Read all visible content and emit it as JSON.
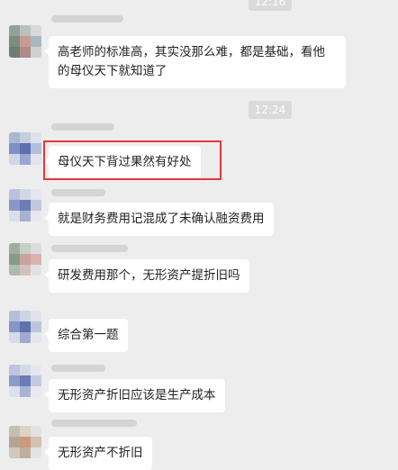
{
  "timestamps": [
    "12:16",
    "12:24"
  ],
  "messages": [
    {
      "text": "高老师的标准高，其实没那么难，都是基础，看他的母仪天下就知道了"
    },
    {
      "text": "母仪天下背过果然有好处"
    },
    {
      "text": "就是财务费用记混成了未确认融资费用"
    },
    {
      "text": "研发费用那个，无形资产提折旧吗"
    },
    {
      "text": "综合第一题"
    },
    {
      "text": "无形资产折旧应该是生产成本"
    },
    {
      "text": "无形资产不折旧"
    }
  ],
  "colors": {
    "background": "#ededed",
    "bubble": "#ffffff",
    "highlight_border": "#e53935",
    "timestamp_bg": "#dadada"
  }
}
